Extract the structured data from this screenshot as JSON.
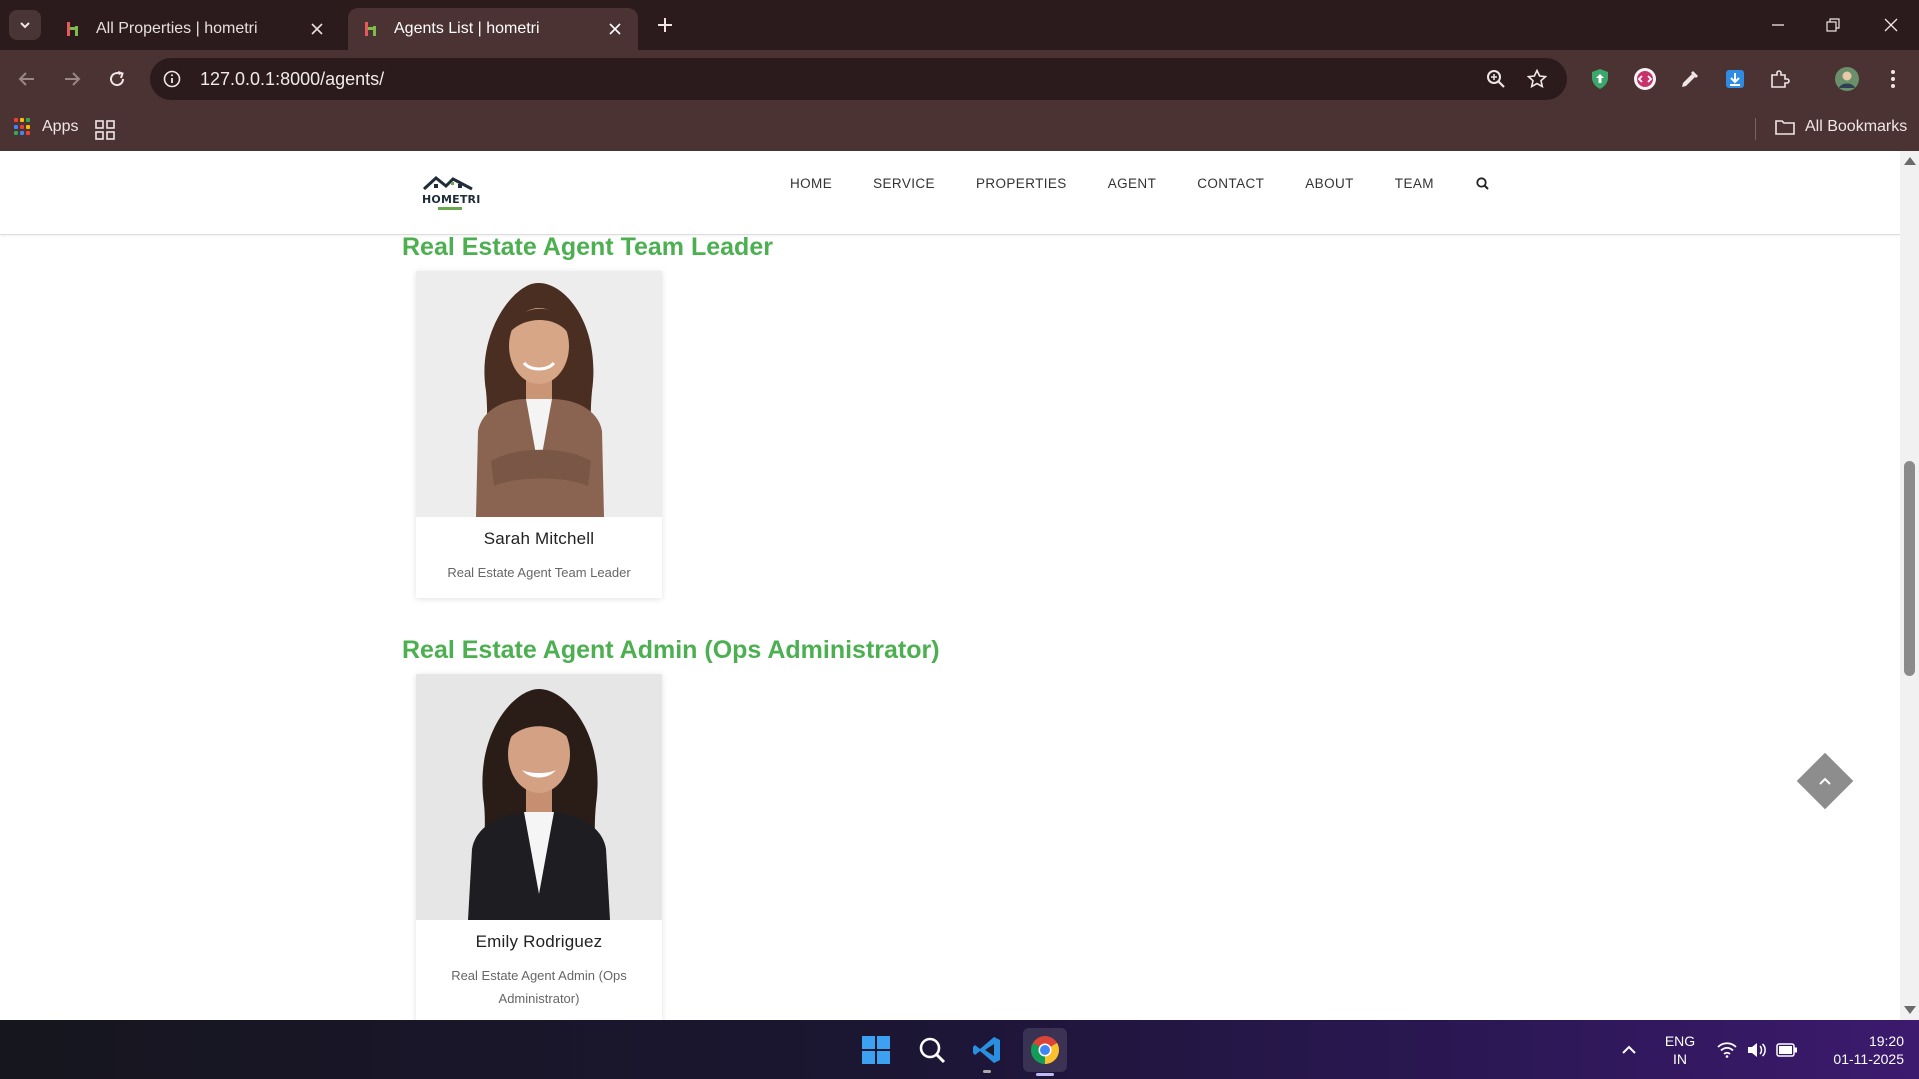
{
  "browser": {
    "tabs": [
      {
        "title": "All Properties | hometri",
        "active": false
      },
      {
        "title": "Agents List | hometri",
        "active": true
      }
    ],
    "url": "127.0.0.1:8000/agents/",
    "bookmarks": {
      "apps_label": "Apps",
      "all_bookmarks_label": "All Bookmarks"
    }
  },
  "site": {
    "logo_text": "HOMETRI",
    "nav": [
      "HOME",
      "SERVICE",
      "PROPERTIES",
      "AGENT",
      "CONTACT",
      "ABOUT",
      "TEAM"
    ]
  },
  "sections": [
    {
      "title": "Real Estate Agent Team Leader",
      "agents": [
        {
          "name": "Sarah Mitchell",
          "role": "Real Estate Agent Team Leader"
        }
      ]
    },
    {
      "title": "Real Estate Agent Admin (Ops Administrator)",
      "agents": [
        {
          "name": "Emily Rodriguez",
          "role": "Real Estate Agent Admin (Ops Administrator)"
        }
      ]
    }
  ],
  "taskbar": {
    "language": "ENG",
    "region": "IN",
    "time": "19:20",
    "date": "01-11-2025"
  },
  "colors": {
    "accent_green": "#4caf50",
    "chrome_dark": "#2b1b1c",
    "chrome_toolbar": "#4b3233"
  }
}
